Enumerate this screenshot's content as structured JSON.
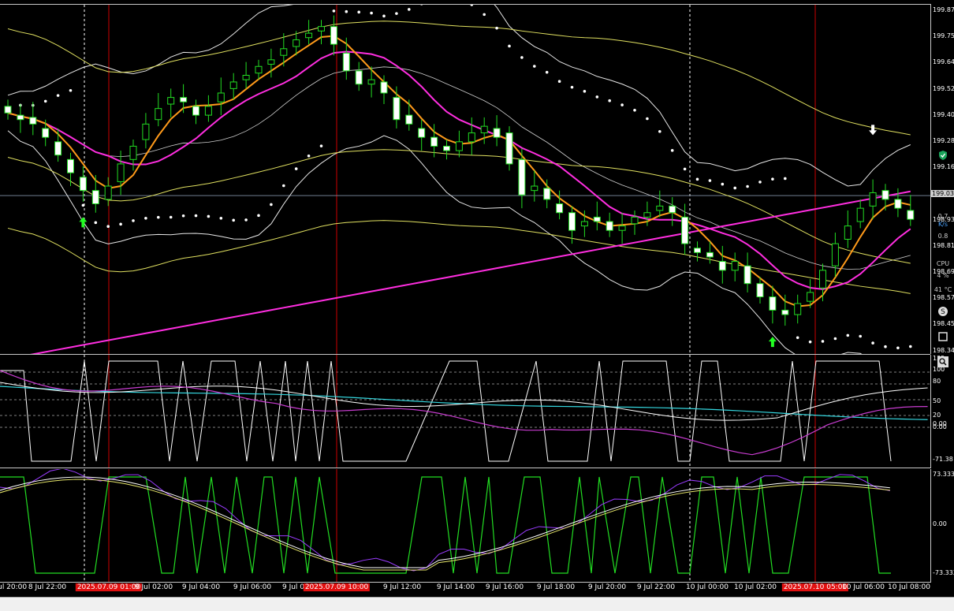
{
  "main": {
    "price_ticks": [
      "199.87",
      "199.75",
      "199.64",
      "199.52",
      "199.40",
      "199.28",
      "199.16",
      "199.05",
      "198.93",
      "198.81",
      "198.69",
      "198.57",
      "198.45",
      "198.34"
    ],
    "current_price": "199.03",
    "arrows": {
      "up": [
        {
          "bar": 6
        },
        {
          "bar": 61
        }
      ],
      "down": [
        {
          "bar": 25
        },
        {
          "bar": 69
        }
      ]
    }
  },
  "osc1": {
    "ticks": [
      "135",
      "100",
      "80",
      "50",
      "20",
      "0.00",
      "0.00",
      "-71.38"
    ]
  },
  "osc2": {
    "ticks": [
      "73.333",
      "0.00",
      "-73.333"
    ]
  },
  "time_axis": {
    "labels": [
      {
        "text": "8 Jul 20:00",
        "hl": false
      },
      {
        "text": "8 Jul 22:00",
        "hl": false
      },
      {
        "text": "2025.07.09 01:00",
        "hl": true
      },
      {
        "text": "9 Jul 02:00",
        "hl": false
      },
      {
        "text": "9 Jul 04:00",
        "hl": false
      },
      {
        "text": "9 Jul 06:00",
        "hl": false
      },
      {
        "text": "9 Jul 0",
        "hl": false
      },
      {
        "text": "2025.07.09 10:00",
        "hl": true
      },
      {
        "text": "9 Jul 12:00",
        "hl": false
      },
      {
        "text": "9 Jul 14:00",
        "hl": false
      },
      {
        "text": "9 Jul 16:00",
        "hl": false
      },
      {
        "text": "9 Jul 18:00",
        "hl": false
      },
      {
        "text": "9 Jul 20:00",
        "hl": false
      },
      {
        "text": "9 Jul 22:00",
        "hl": false
      },
      {
        "text": "10 Jul 00:00",
        "hl": false
      },
      {
        "text": "10 Jul 02:00",
        "hl": false
      },
      {
        "text": "2025.07.10 05:00",
        "hl": true
      },
      {
        "text": "10 Jul 06:00",
        "hl": false
      },
      {
        "text": "10 Jul 08:00",
        "hl": false
      }
    ]
  },
  "side_widgets": {
    "w1": "0.7",
    "w2": "K/s",
    "w3": "0.8",
    "w4": "CPU",
    "w5": "4 %",
    "w6": "41 °C"
  },
  "chart_data": {
    "type": "candlestick",
    "title": "",
    "close": [
      199.41,
      199.38,
      199.36,
      199.3,
      199.22,
      199.14,
      199.06,
      199.0,
      199.08,
      199.18,
      199.26,
      199.36,
      199.43,
      199.48,
      199.46,
      199.4,
      199.44,
      199.5,
      199.55,
      199.58,
      199.62,
      199.65,
      199.7,
      199.74,
      199.77,
      199.8,
      199.72,
      199.6,
      199.54,
      199.56,
      199.5,
      199.38,
      199.36,
      199.3,
      199.26,
      199.24,
      199.28,
      199.32,
      199.35,
      199.3,
      199.18,
      199.04,
      199.08,
      199.02,
      198.96,
      198.88,
      198.92,
      198.92,
      198.88,
      198.9,
      198.94,
      198.96,
      198.99,
      198.96,
      198.82,
      198.78,
      198.76,
      198.7,
      198.74,
      198.64,
      198.58,
      198.52,
      198.5,
      198.55,
      198.6,
      198.7,
      198.82,
      198.9,
      198.98,
      199.05,
      199.02,
      198.98,
      198.93
    ],
    "open": [
      199.44,
      199.4,
      199.39,
      199.34,
      199.28,
      199.2,
      199.12,
      199.06,
      199.02,
      199.1,
      199.2,
      199.29,
      199.38,
      199.45,
      199.48,
      199.44,
      199.4,
      199.46,
      199.52,
      199.56,
      199.59,
      199.63,
      199.67,
      199.71,
      199.75,
      199.78,
      199.8,
      199.68,
      199.6,
      199.54,
      199.55,
      199.48,
      199.4,
      199.34,
      199.3,
      199.26,
      199.24,
      199.28,
      199.32,
      199.34,
      199.32,
      199.2,
      199.06,
      199.07,
      199.0,
      198.96,
      198.9,
      198.94,
      198.92,
      198.88,
      198.91,
      198.94,
      198.97,
      198.99,
      198.94,
      198.8,
      198.78,
      198.74,
      198.7,
      198.72,
      198.64,
      198.58,
      198.52,
      198.5,
      198.56,
      198.62,
      198.72,
      198.84,
      198.92,
      198.99,
      199.06,
      199.02,
      198.97
    ]
  }
}
